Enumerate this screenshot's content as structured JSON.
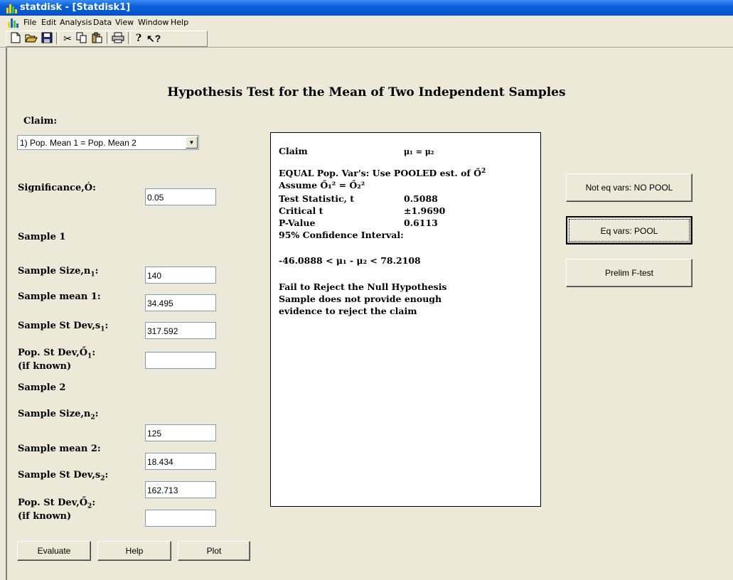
{
  "window": {
    "title": "statdisk - [Statdisk1]"
  },
  "menu": [
    "File",
    "Edit",
    "Analysis",
    "Data",
    "View",
    "Window",
    "Help"
  ],
  "toolbar_icons": [
    "new-icon",
    "open-icon",
    "save-icon",
    "cut-icon",
    "copy-icon",
    "paste-icon",
    "print-icon",
    "help-icon",
    "context-help-icon"
  ],
  "heading": "Hypothesis Test for the Mean of Two Independent Samples",
  "claim": {
    "label": "Claim:",
    "selected": "1) Pop. Mean 1 = Pop. Mean 2"
  },
  "significance": {
    "label": "Significance,Ó:",
    "value": "0.05"
  },
  "sample1": {
    "header": "Sample 1",
    "size_label": "Sample Size,n",
    "size_sub": "1",
    "size_suffix": ":",
    "size_value": "140",
    "mean_label": "Sample mean 1:",
    "mean_value": "34.495",
    "sd_label": "Sample St Dev,s",
    "sd_sub": "1",
    "sd_suffix": ":",
    "sd_value": "317.592",
    "pop_sd_label": "Pop. St Dev,Ő",
    "pop_sd_sub": "1",
    "pop_sd_suffix": ":",
    "pop_sd_note": "(if known)",
    "pop_sd_value": ""
  },
  "sample2": {
    "header": "Sample 2",
    "size_label": "Sample Size,n",
    "size_sub": "2",
    "size_suffix": ":",
    "size_value": "125",
    "mean_label": "Sample mean 2:",
    "mean_value": "18.434",
    "sd_label": "Sample St Dev,s",
    "sd_sub": "2",
    "sd_suffix": ":",
    "sd_value": "162.713",
    "pop_sd_label": "Pop. St Dev,Ő",
    "pop_sd_sub": "2",
    "pop_sd_suffix": ":",
    "pop_sd_note": "(if known)",
    "pop_sd_value": ""
  },
  "buttons": {
    "evaluate": "Evaluate",
    "help": "Help",
    "plot": "Plot",
    "no_pool": "Not eq vars: NO POOL",
    "pool": "Eq vars: POOL",
    "ftest": "Prelim F-test"
  },
  "result": {
    "claim_label": "Claim",
    "claim_value": "μ₁ = μ₂",
    "equal_line": "EQUAL Pop. Var's: Use POOLED est. of Ő",
    "equal_sup": "2",
    "assume_line": "Assume Ő₁² = Ő₂²",
    "stat_label": "Test Statistic, t",
    "stat_value": "0.5088",
    "crit_label": "Critical t",
    "crit_value": "±1.9690",
    "p_label": "P-Value",
    "p_value": "0.6113",
    "ci_label": "95% Confidence Interval:",
    "ci_value": "-46.0888 < μ₁ - μ₂ < 78.2108",
    "conclusion1": "Fail to Reject the Null Hypothesis",
    "conclusion2": "Sample does not provide enough",
    "conclusion3": "evidence to reject the claim"
  }
}
